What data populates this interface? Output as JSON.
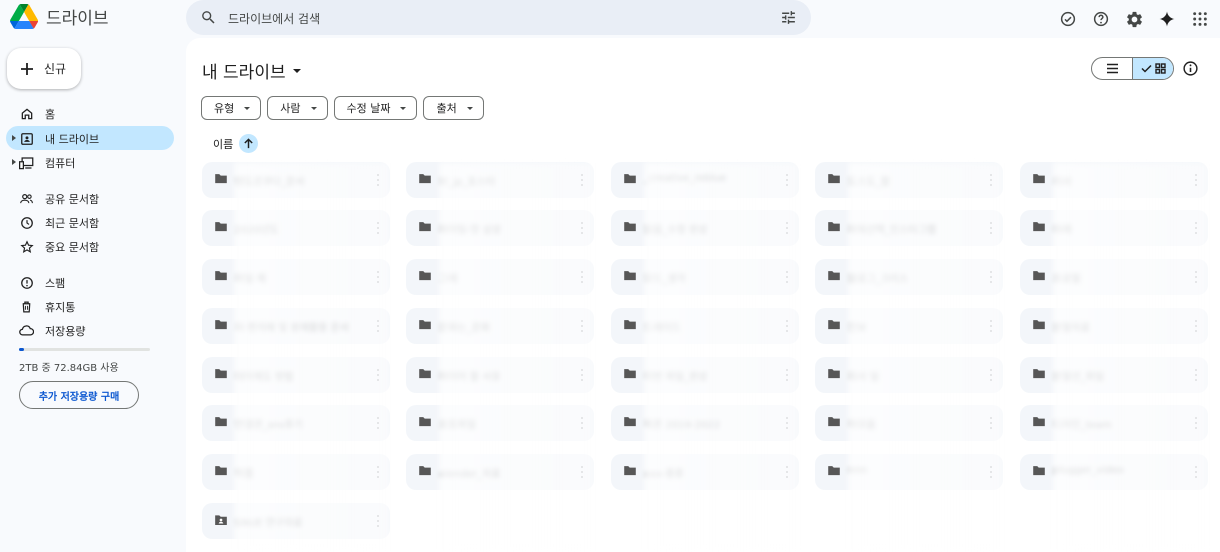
{
  "app": {
    "name": "드라이브"
  },
  "search": {
    "placeholder": "드라이브에서 검색"
  },
  "sidebar": {
    "new_label": "신규",
    "items": [
      {
        "label": "홈",
        "icon": "home-icon"
      },
      {
        "label": "내 드라이브",
        "icon": "my-drive-icon",
        "active": true
      },
      {
        "label": "컴퓨터",
        "icon": "computer-icon"
      },
      {
        "label": "공유 문서함",
        "icon": "people-icon"
      },
      {
        "label": "최근 문서함",
        "icon": "clock-icon"
      },
      {
        "label": "중요 문서함",
        "icon": "star-icon"
      },
      {
        "label": "스팸",
        "icon": "spam-icon"
      },
      {
        "label": "휴지통",
        "icon": "trash-icon"
      },
      {
        "label": "저장용량",
        "icon": "cloud-icon"
      }
    ],
    "storage_text": "2TB 중 72.84GB 사용",
    "storage_used_fraction": 0.036,
    "buy_label": "추가 저장용량 구매"
  },
  "main": {
    "title": "내 드라이브",
    "filters": [
      "유형",
      "사람",
      "수정 날짜",
      "출처"
    ],
    "sort_label": "이름",
    "columns": [
      [
        "텐도르쿠다_문서",
        "2020년도",
        "파일 제",
        "자·편저에 및 원재활용 문서",
        "데이제도 방법",
        "연결관_sns후기",
        "작품"
      ],
      [
        "브_jp_포스터",
        "파이팅-맛 삼성",
        "그레",
        "문화는_문화",
        "파이어 할 사유",
        "포토파일",
        "alender_자료"
      ],
      [
        "_creative_reblue",
        "읽음_수정 완성",
        "모드_생각",
        "드레이드",
        "이번 파일_완성",
        "목폰 2019-2022",
        "xxx-종류"
      ],
      [
        "도스도_함",
        "파워선택_인스타그램",
        "블로그_크리스",
        "진보",
        "회사 일",
        "하모음",
        "nnn"
      ],
      [
        "리사",
        "아래",
        "프로필",
        "분할자료",
        "분할선_파일",
        "디자인_team",
        "plugger_video"
      ]
    ],
    "last_item": "SNUE 연구자료"
  }
}
